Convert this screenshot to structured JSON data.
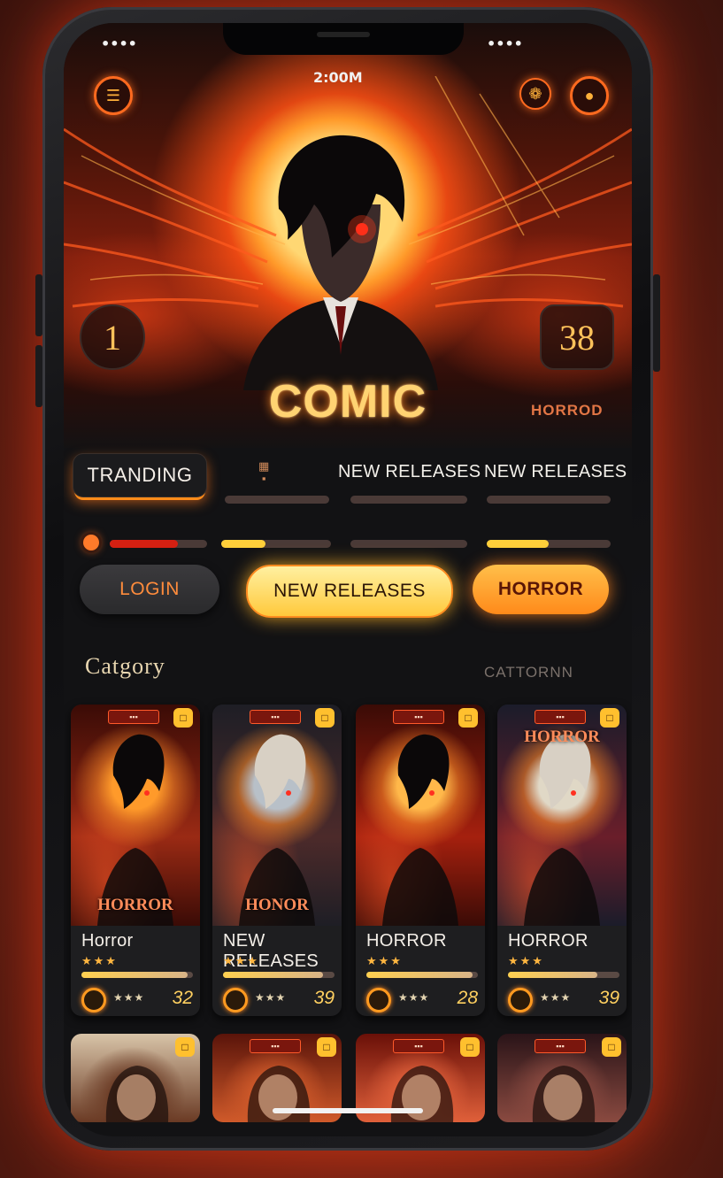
{
  "status_bar": {
    "left": "••••",
    "right": "••••",
    "time": "2:00M"
  },
  "hero": {
    "title": "COMIC",
    "left_stat": "1",
    "right_stat": "38",
    "left_tag": "",
    "right_tag": "HORROD",
    "menu_icon": "menu-icon",
    "right_icons": [
      "swirl-icon",
      "profile-icon"
    ]
  },
  "tabs": {
    "active": "TRANDING",
    "tab2": "NEW RELEASES",
    "tab3": "NEW RELEASES",
    "progress": [
      {
        "fill": 0.7,
        "color": "#d42012"
      },
      {
        "fill": 0.4,
        "color": "#ffcf3a"
      },
      {
        "fill": 0.0,
        "color": "#d42012"
      },
      {
        "fill": 0.5,
        "color": "#ffcf3a"
      }
    ]
  },
  "actions": {
    "login": "LOGIN",
    "new_releases": "NEW RELEASES",
    "horror": "HORROR"
  },
  "section": {
    "title": "Catgory",
    "right_label": "CATTORNN"
  },
  "cards": [
    {
      "art_title": "HORROR",
      "name": "Horror",
      "stars": "★★★",
      "progress": 0.95,
      "foot_stars": "★★★",
      "count": "32",
      "theme": [
        "#3a0b06",
        "#9a2a14",
        "#ff9a2a"
      ]
    },
    {
      "art_title": "HONOR",
      "name": "NEW RELEASES",
      "stars": "★★★",
      "progress": 0.9,
      "foot_stars": "★★★",
      "count": "39",
      "theme": [
        "#1e1e25",
        "#4c2a2a",
        "#b8c0c8"
      ]
    },
    {
      "art_title": "",
      "name": "HORROR",
      "stars": "★★★",
      "progress": 0.95,
      "foot_stars": "★★★",
      "count": "28",
      "theme": [
        "#3a0b06",
        "#a5200e",
        "#ffb84a"
      ]
    },
    {
      "art_title": "HORROR",
      "name": "HORROR",
      "stars": "★★★",
      "progress": 0.8,
      "foot_stars": "★★★",
      "count": "39",
      "theme": [
        "#1b1c2a",
        "#6a1e2a",
        "#e0d8c6"
      ]
    }
  ],
  "mini_cards": [
    {
      "theme": [
        "#d8c4a8",
        "#6a3a24"
      ]
    },
    {
      "theme": [
        "#5a140a",
        "#d05a2a"
      ]
    },
    {
      "theme": [
        "#6a1008",
        "#e0603a"
      ]
    },
    {
      "theme": [
        "#2a1418",
        "#8a4a40"
      ]
    }
  ]
}
